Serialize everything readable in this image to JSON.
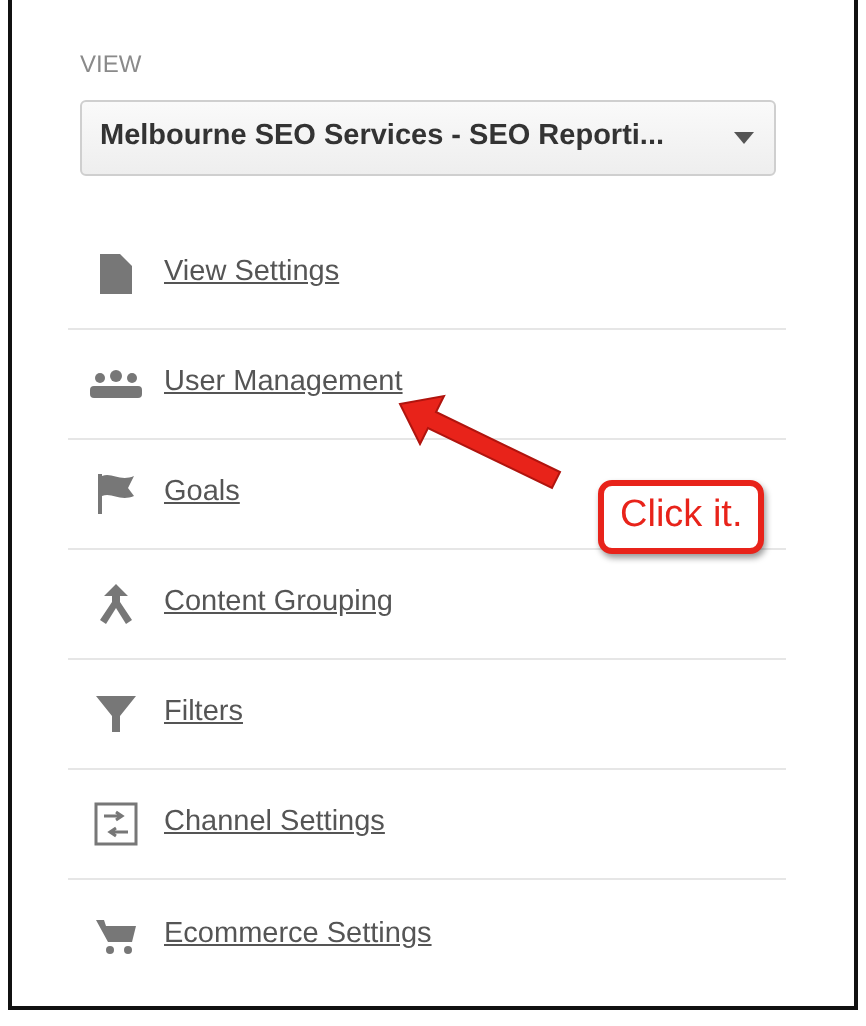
{
  "view": {
    "label": "VIEW",
    "selected_view": "Melbourne SEO Services - SEO Reporti..."
  },
  "menu": [
    {
      "label": "View Settings"
    },
    {
      "label": "User Management"
    },
    {
      "label": "Goals"
    },
    {
      "label": "Content Grouping"
    },
    {
      "label": "Filters"
    },
    {
      "label": "Channel Settings"
    },
    {
      "label": "Ecommerce Settings"
    }
  ],
  "annotation": {
    "callout": "Click it."
  }
}
